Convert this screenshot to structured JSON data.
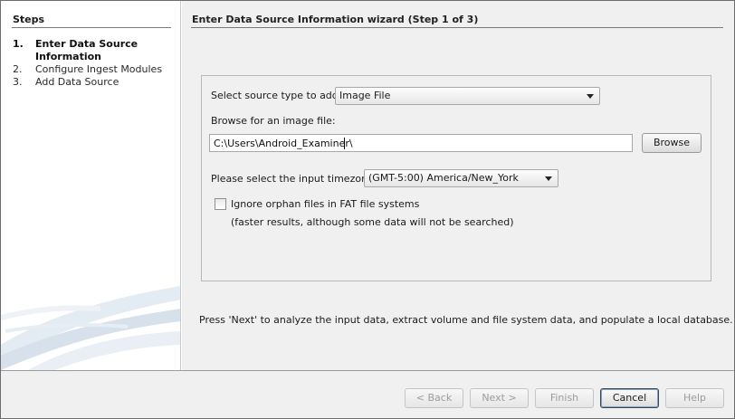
{
  "steps": {
    "title": "Steps",
    "items": [
      {
        "number": "1.",
        "label": "Enter Data Source Information",
        "current": true
      },
      {
        "number": "2.",
        "label": "Configure Ingest Modules",
        "current": false
      },
      {
        "number": "3.",
        "label": "Add Data Source",
        "current": false
      }
    ]
  },
  "wizard": {
    "header": "Enter Data Source Information wizard (Step 1 of 3)"
  },
  "form": {
    "source_type_label": "Select source type to add:",
    "source_type_value": "Image File",
    "browse_label": "Browse for an image file:",
    "image_path_value": "C:\\Users\\Android_Examiner\\",
    "browse_button": "Browse",
    "timezone_label": "Please select the input timezone:",
    "timezone_value": "(GMT-5:00) America/New_York",
    "orphan_checkbox_label": "Ignore orphan files in FAT file systems",
    "orphan_checkbox_checked": false,
    "orphan_note": "(faster results, although some data will not be searched)"
  },
  "footer_note": "Press 'Next' to analyze the input data, extract volume and file system data, and populate a local database.",
  "buttons": {
    "back": "< Back",
    "next": "Next >",
    "finish": "Finish",
    "cancel": "Cancel",
    "help": "Help"
  },
  "colors": {
    "pane_background": "#f0f0f0",
    "default_button_focus": "#7da2ce"
  }
}
